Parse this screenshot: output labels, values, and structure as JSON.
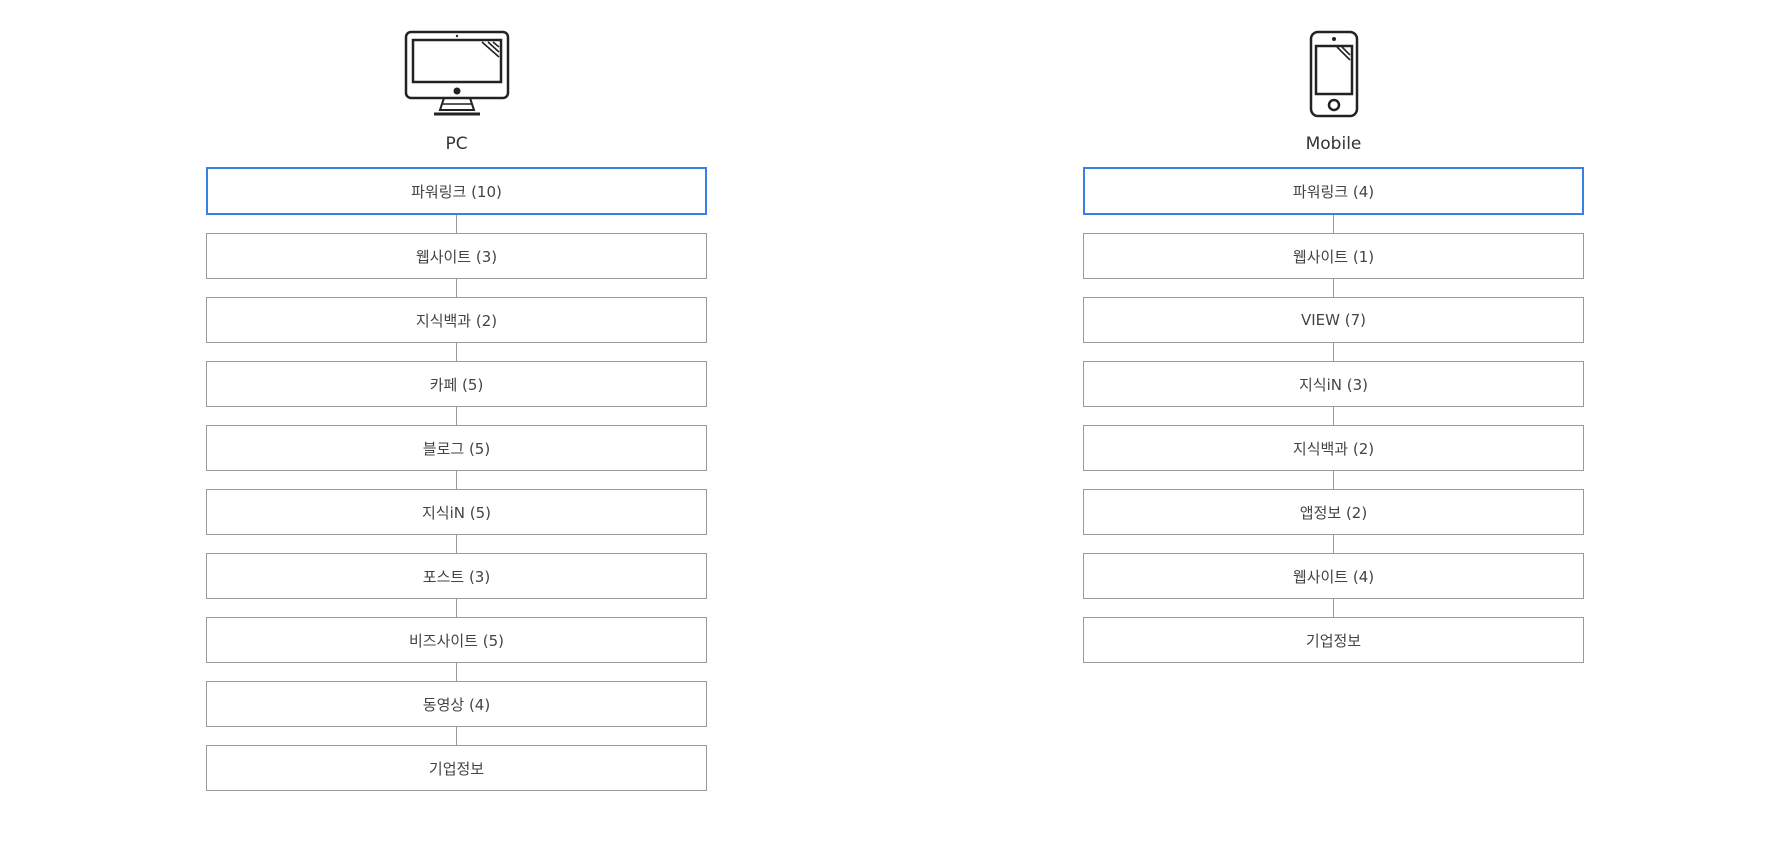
{
  "pc": {
    "label": "PC",
    "icon": "desktop-monitor-icon",
    "items": [
      {
        "label": "파워링크 (10)",
        "active": true
      },
      {
        "label": "웹사이트 (3)"
      },
      {
        "label": "지식백과 (2)"
      },
      {
        "label": "카페 (5)"
      },
      {
        "label": "블로그 (5)"
      },
      {
        "label": "지식iN (5)"
      },
      {
        "label": "포스트 (3)"
      },
      {
        "label": "비즈사이트 (5)"
      },
      {
        "label": "동영상 (4)"
      },
      {
        "label": "기업정보"
      }
    ]
  },
  "mobile": {
    "label": "Mobile",
    "icon": "smartphone-icon",
    "items": [
      {
        "label": "파워링크 (4)",
        "active": true
      },
      {
        "label": "웹사이트 (1)"
      },
      {
        "label": "VIEW (7)"
      },
      {
        "label": "지식iN (3)"
      },
      {
        "label": "지식백과 (2)"
      },
      {
        "label": "앱정보 (2)"
      },
      {
        "label": "웹사이트 (4)"
      },
      {
        "label": "기업정보"
      }
    ]
  },
  "colors": {
    "active_border": "#3a7fe4",
    "box_border": "#9a9a9a",
    "text": "#444444"
  }
}
